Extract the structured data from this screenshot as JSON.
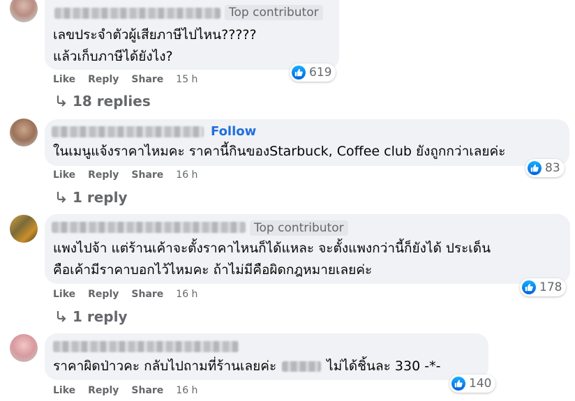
{
  "comments": [
    {
      "badge": "Top contributor",
      "line1": "เลขประจำตัวผู้เสียภาษีไปไหน?????",
      "line2": "แล้วเก็บภาษีได้ยังไง?",
      "reactions": "619",
      "actions": {
        "like": "Like",
        "reply": "Reply",
        "share": "Share",
        "time": "15 h"
      },
      "replies": "18 replies"
    },
    {
      "follow": "Follow",
      "line1": "ในเมนูแจ้งราคาไหมคะ ราคานี้กินของStarbuck, Coffee club ยังถูกกว่าเลยค่ะ",
      "reactions": "83",
      "actions": {
        "like": "Like",
        "reply": "Reply",
        "share": "Share",
        "time": "16 h"
      },
      "replies": "1 reply"
    },
    {
      "badge": "Top contributor",
      "line1": "แพงไปจ้า แต่ร้านเค้าจะตั้งราคาไหนก็ได้แหละ จะตั้งแพงกว่านี้ก็ยังได้ ประเด็น",
      "line2": "คือเค้ามีราคาบอกไว้ไหมคะ ถ้าไม่มีคือผิดกฎหมายเลยค่ะ",
      "reactions": "178",
      "actions": {
        "like": "Like",
        "reply": "Reply",
        "share": "Share",
        "time": "16 h"
      },
      "replies": "1 reply"
    },
    {
      "line1a": "ราคาผิดป่าวคะ กลับไปถามที่ร้านเลยค่ะ",
      "line1b": "ไม่ได้ชิ้นละ 330 -*-",
      "reactions": "140",
      "actions": {
        "like": "Like",
        "reply": "Reply",
        "share": "Share",
        "time": "16 h"
      }
    }
  ],
  "colors": {
    "bubble": "#f0f2f5",
    "link": "#216fdb",
    "meta": "#65676b",
    "like": "#0062df"
  }
}
